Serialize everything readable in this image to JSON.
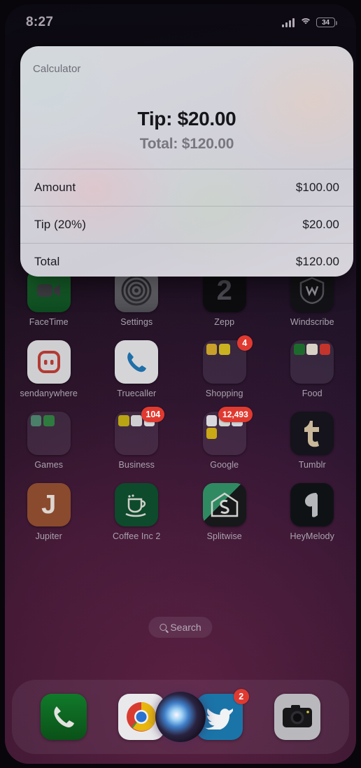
{
  "status_bar": {
    "time": "8:27",
    "cellular_icon": "signal-bars-icon",
    "wifi_icon": "wifi-icon",
    "battery_level": "34"
  },
  "calculator_panel": {
    "title": "Calculator",
    "headline": "Tip: $20.00",
    "subheadline": "Total: $120.00",
    "rows": [
      {
        "label": "Amount",
        "value": "$100.00"
      },
      {
        "label": "Tip (20%)",
        "value": "$20.00"
      },
      {
        "label": "Total",
        "value": "$120.00"
      }
    ]
  },
  "home_screen": {
    "rows": [
      [
        {
          "label": "FaceTime",
          "icon": "facetime-icon",
          "badge": ""
        },
        {
          "label": "Settings",
          "icon": "settings-icon",
          "badge": ""
        },
        {
          "label": "Zepp",
          "icon": "zepp-icon",
          "badge": ""
        },
        {
          "label": "Windscribe",
          "icon": "windscribe-icon",
          "badge": ""
        }
      ],
      [
        {
          "label": "sendanywhere",
          "icon": "sendanywhere-icon",
          "badge": ""
        },
        {
          "label": "Truecaller",
          "icon": "truecaller-icon",
          "badge": ""
        },
        {
          "label": "Shopping",
          "icon": "shopping-folder",
          "badge": "4"
        },
        {
          "label": "Food",
          "icon": "food-folder",
          "badge": ""
        }
      ],
      [
        {
          "label": "Games",
          "icon": "games-folder",
          "badge": ""
        },
        {
          "label": "Business",
          "icon": "business-folder",
          "badge": "104"
        },
        {
          "label": "Google",
          "icon": "google-folder",
          "badge": "12,493"
        },
        {
          "label": "Tumblr",
          "icon": "tumblr-icon",
          "badge": ""
        }
      ],
      [
        {
          "label": "Jupiter",
          "icon": "jupiter-icon",
          "badge": ""
        },
        {
          "label": "Coffee Inc 2",
          "icon": "coffee-inc-2-icon",
          "badge": ""
        },
        {
          "label": "Splitwise",
          "icon": "splitwise-icon",
          "badge": ""
        },
        {
          "label": "HeyMelody",
          "icon": "heymelody-icon",
          "badge": ""
        }
      ]
    ],
    "search": {
      "label": "Search",
      "icon": "search-icon"
    },
    "dock": [
      {
        "label": "Phone",
        "icon": "phone-icon",
        "badge": ""
      },
      {
        "label": "Chrome",
        "icon": "chrome-icon",
        "badge": ""
      },
      {
        "label": "Twitter",
        "icon": "twitter-icon",
        "badge": "2"
      },
      {
        "label": "Camera",
        "icon": "camera-icon",
        "badge": ""
      }
    ],
    "siri_overlay": "siri-orb-icon"
  },
  "colors": {
    "badge_red": "#e03a30",
    "facetime_green": "#165c28",
    "phone_green": "#0d5e22",
    "jupiter_brown": "#8a4a2e",
    "coffee_green": "#0e4a2c",
    "twitter_blue": "#1b74a8",
    "label_gray": "#a9a3ae"
  }
}
